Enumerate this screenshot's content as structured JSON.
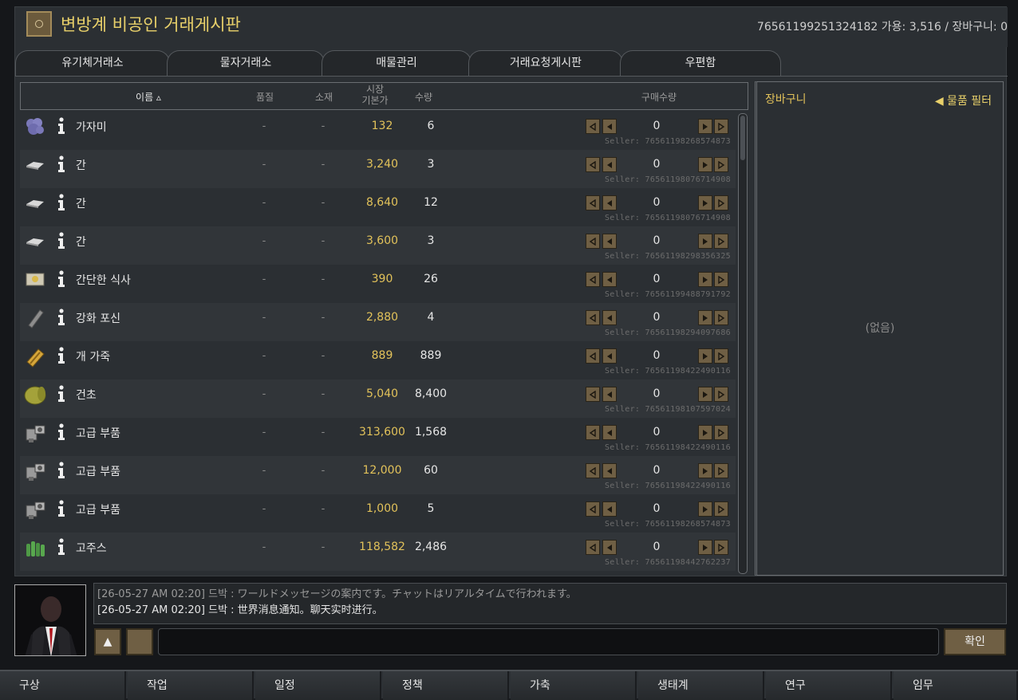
{
  "window": {
    "title": "변방계 비공인 거래게시판",
    "account_info": "76561199251324182   가용: 3,516 / 장바구니: 0"
  },
  "tabs": [
    {
      "label": "유기체거래소"
    },
    {
      "label": "물자거래소"
    },
    {
      "label": "매물관리"
    },
    {
      "label": "거래요청게시판"
    },
    {
      "label": "우편함"
    }
  ],
  "table": {
    "headers": {
      "name": "이름 ▵",
      "quality": "품질",
      "stuff": "소재",
      "price_line1": "시장",
      "price_line2": "기본가",
      "qty": "수량",
      "buy_qty": "구매수량"
    },
    "rows": [
      {
        "icon": "wool-icon",
        "name": "가자미",
        "quality": "-",
        "stuff": "-",
        "price": "132",
        "qty": "6",
        "count": "0",
        "seller": "Seller: 76561198268574873"
      },
      {
        "icon": "meat-icon",
        "name": "간",
        "quality": "-",
        "stuff": "-",
        "price": "3,240",
        "qty": "3",
        "count": "0",
        "seller": "Seller: 76561198076714908"
      },
      {
        "icon": "meat-icon",
        "name": "간",
        "quality": "-",
        "stuff": "-",
        "price": "8,640",
        "qty": "12",
        "count": "0",
        "seller": "Seller: 76561198076714908"
      },
      {
        "icon": "meat-icon",
        "name": "간",
        "quality": "-",
        "stuff": "-",
        "price": "3,600",
        "qty": "3",
        "count": "0",
        "seller": "Seller: 76561198298356325"
      },
      {
        "icon": "meal-icon",
        "name": "간단한 식사",
        "quality": "-",
        "stuff": "-",
        "price": "390",
        "qty": "26",
        "count": "0",
        "seller": "Seller: 76561199488791792"
      },
      {
        "icon": "cannon-icon",
        "name": "강화 포신",
        "quality": "-",
        "stuff": "-",
        "price": "2,880",
        "qty": "4",
        "count": "0",
        "seller": "Seller: 76561198294097686"
      },
      {
        "icon": "leather-icon",
        "name": "개 가죽",
        "quality": "-",
        "stuff": "-",
        "price": "889",
        "qty": "889",
        "count": "0",
        "seller": "Seller: 76561198422490116"
      },
      {
        "icon": "hay-icon",
        "name": "건초",
        "quality": "-",
        "stuff": "-",
        "price": "5,040",
        "qty": "8,400",
        "count": "0",
        "seller": "Seller: 76561198107597024"
      },
      {
        "icon": "component-icon",
        "name": "고급 부품",
        "quality": "-",
        "stuff": "-",
        "price": "313,600",
        "qty": "1,568",
        "count": "0",
        "seller": "Seller: 76561198422490116"
      },
      {
        "icon": "component-icon",
        "name": "고급 부품",
        "quality": "-",
        "stuff": "-",
        "price": "12,000",
        "qty": "60",
        "count": "0",
        "seller": "Seller: 76561198422490116"
      },
      {
        "icon": "component-icon",
        "name": "고급 부품",
        "quality": "-",
        "stuff": "-",
        "price": "1,000",
        "qty": "5",
        "count": "0",
        "seller": "Seller: 76561198268574873"
      },
      {
        "icon": "pepper-icon",
        "name": "고주스",
        "quality": "-",
        "stuff": "-",
        "price": "118,582",
        "qty": "2,486",
        "count": "0",
        "seller": "Seller: 76561198442762237"
      }
    ]
  },
  "cart": {
    "title": "장바구니",
    "filter_label": "◀ 물품 필터",
    "empty_text": "(없음)"
  },
  "chat": {
    "messages": [
      {
        "text": "[26-05-27 AM 02:20] 드박 : ワールドメッセージの案内です。チャットはリアルタイムで行われます。",
        "style": "old"
      },
      {
        "text": "[26-05-27 AM 02:20] 드박 : 世界消息通知。聊天实时进行。",
        "style": "new"
      }
    ],
    "input_value": "",
    "up_button": "▲",
    "confirm_label": "확인"
  },
  "bottom_bar": [
    {
      "label": "구상"
    },
    {
      "label": "작업"
    },
    {
      "label": "일정"
    },
    {
      "label": "정책"
    },
    {
      "label": "가축"
    },
    {
      "label": "생태계"
    },
    {
      "label": "연구"
    },
    {
      "label": "임무"
    }
  ],
  "colors": {
    "accent_gold": "#e2c25a",
    "button_brown": "#6f5f44",
    "panel_bg": "#2b2f33"
  }
}
